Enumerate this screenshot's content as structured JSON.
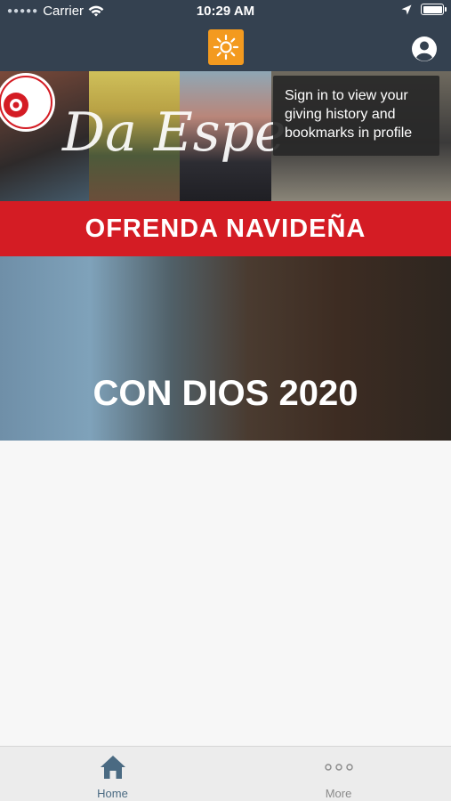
{
  "status_bar": {
    "carrier": "Carrier",
    "time": "10:29 AM"
  },
  "header": {
    "logo_icon": "sun-icon",
    "profile_icon": "user-circle-icon"
  },
  "tooltip": {
    "text": "Sign in to view your giving history and bookmarks in profile"
  },
  "banners": [
    {
      "title": "OFRENDA NAVIDEÑA",
      "script_text": "Da Espe",
      "seal_text": "OFRENDA NAVIDEÑA"
    },
    {
      "title": "CON DIOS 2020"
    }
  ],
  "tabbar": {
    "items": [
      {
        "label": "Home",
        "icon": "home-icon",
        "active": true
      },
      {
        "label": "More",
        "icon": "more-icon",
        "active": false
      }
    ]
  },
  "colors": {
    "header": "#344150",
    "brand_orange": "#f39a1f",
    "banner_red": "#d41c24",
    "tab_active": "#4a6a82"
  }
}
